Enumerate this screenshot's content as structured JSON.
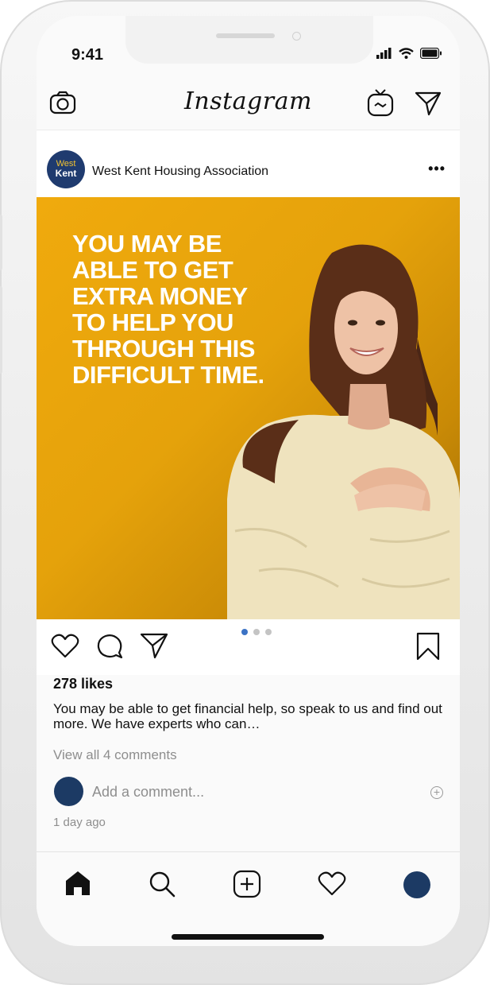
{
  "status_bar": {
    "time": "9:41"
  },
  "header": {
    "app_name": "Instagram"
  },
  "post": {
    "account_name": "West Kent Housing Association",
    "avatar": {
      "line1": "West",
      "line2": "Kent"
    },
    "more_label": "•••",
    "image": {
      "headline": [
        "YOU MAY BE",
        "ABLE TO GET",
        "EXTRA MONEY",
        "TO HELP YOU",
        "THROUGH THIS",
        "DIFFICULT TIME."
      ],
      "background_color": "#f0aa0d"
    },
    "carousel": {
      "total": 3,
      "current": 1
    },
    "likes": "278 likes",
    "caption": "You may be able to get financial help, so speak to us and find out more. We have experts who can…",
    "view_comments": "View all 4 comments",
    "comment_placeholder": "Add a comment...",
    "posted": "1 day ago"
  },
  "icons": {
    "header": [
      "camera-icon",
      "igtv-icon",
      "direct-message-icon"
    ],
    "actions": [
      "heart-icon",
      "comment-icon",
      "share-icon",
      "bookmark-icon"
    ],
    "tabbar": [
      "home-icon",
      "search-icon",
      "new-post-icon",
      "activity-heart-icon",
      "profile-avatar"
    ]
  },
  "colors": {
    "accent": "#3b73c5",
    "brand_navy": "#1f3b6f",
    "image_yellow": "#f0aa0d"
  }
}
